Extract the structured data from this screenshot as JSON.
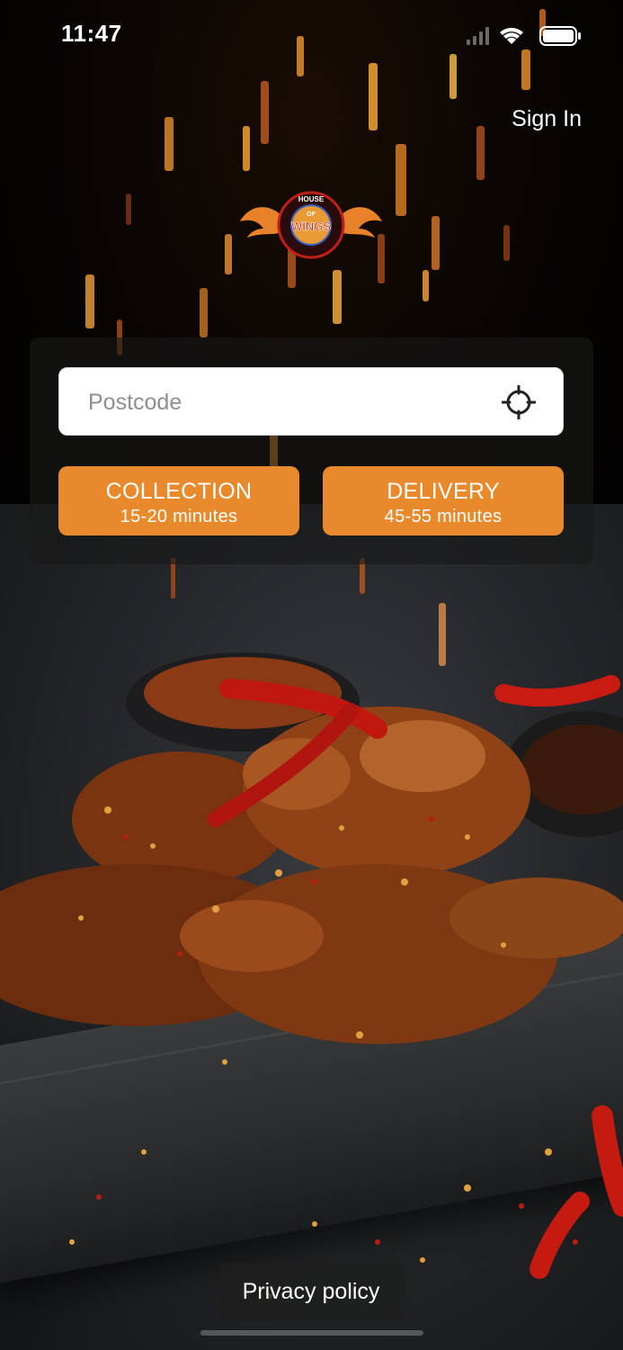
{
  "status_bar": {
    "time": "11:47",
    "icons": [
      "cellular-signal-icon",
      "wifi-icon",
      "battery-icon"
    ]
  },
  "header": {
    "sign_in_label": "Sign In"
  },
  "logo": {
    "line1": "HOUSE",
    "line2": "OF",
    "line3": "WINGS"
  },
  "search": {
    "placeholder": "Postcode",
    "value": "",
    "locate_icon": "crosshair-location-icon"
  },
  "order_options": {
    "collection": {
      "label": "COLLECTION",
      "time": "15-20 minutes"
    },
    "delivery": {
      "label": "DELIVERY",
      "time": "45-55 minutes"
    }
  },
  "footer": {
    "privacy_label": "Privacy policy"
  },
  "colors": {
    "accent": "#e8892c",
    "panel": "rgba(25,25,25,0.62)",
    "text_on_dark": "#ffffff"
  }
}
